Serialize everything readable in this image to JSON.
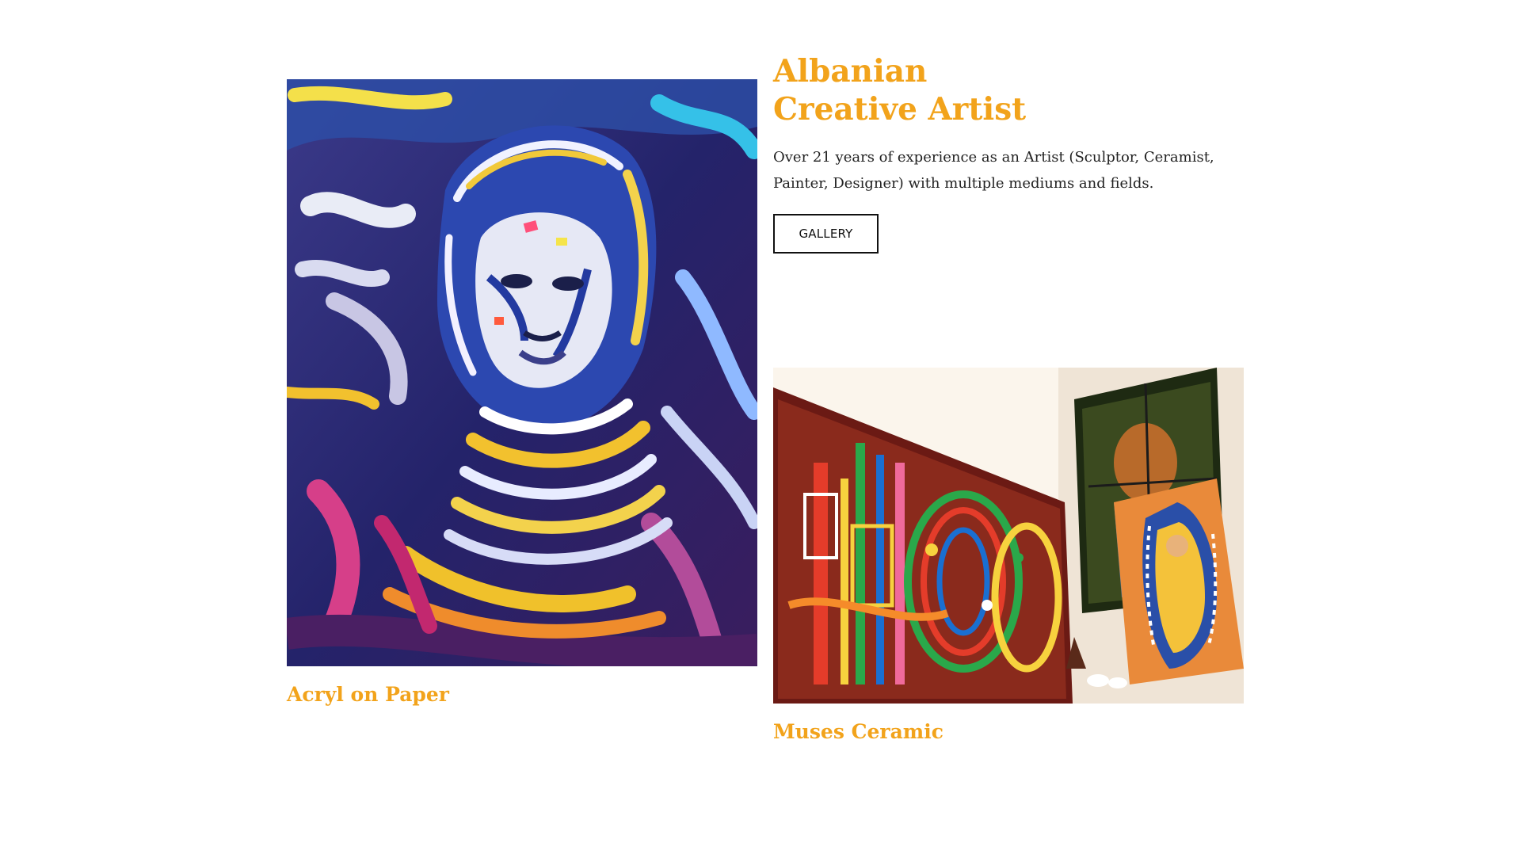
{
  "hero": {
    "title_line1": "Albanian",
    "title_line2": "Creative Artist",
    "description": "Over 21 years of experience as an Artist (Sculptor, Ceramist, Painter, Designer) with multiple mediums and fields.",
    "button_label": "GALLERY"
  },
  "artworks": [
    {
      "caption": "Acryl on Paper",
      "image": "expressionist-acrylic-portrait-painting"
    },
    {
      "caption": "Muses Ceramic",
      "image": "ceramic-muses-artwork-display"
    }
  ],
  "colors": {
    "accent": "#f2a31b",
    "text": "#222222",
    "background": "#ffffff"
  }
}
